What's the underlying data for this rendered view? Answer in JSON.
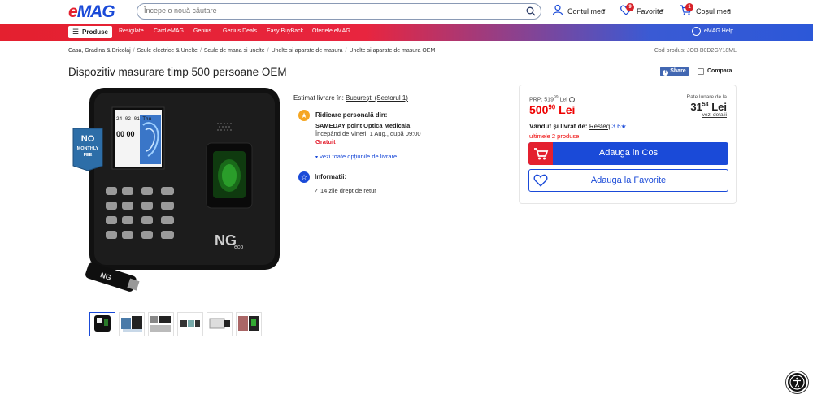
{
  "header": {
    "logo": "eMAG",
    "search_placeholder": "Începe o nouă căutare",
    "account_label": "Contul meu",
    "favorites_label": "Favorite",
    "favorites_count": "9",
    "cart_label": "Coșul meu",
    "cart_count": "1"
  },
  "nav": {
    "produse_label": "Produse",
    "links": [
      "Resigilate",
      "Card eMAG",
      "Genius",
      "Genius Deals",
      "Easy BuyBack",
      "Ofertele eMAG"
    ],
    "help_label": "eMAG Help"
  },
  "breadcrumb": [
    "Casa, Gradina & Bricolaj",
    "Scule electrice & Unelte",
    "Scule de mana si unelte",
    "Unelte si aparate de masura",
    "Unelte si aparate de masura OEM"
  ],
  "product": {
    "code_label": "Cod produs: JOB-B0D2GY18ML",
    "title": "Dispozitiv masurare timp 500 persoane OEM",
    "share_label": "Share",
    "compare_label": "Compara",
    "badge_line1": "NO",
    "badge_line2": "MONTHLY",
    "badge_line3": "FEE",
    "screen_date": "24-02-01 Thu",
    "screen_time": "00 00",
    "brand": "NGeco"
  },
  "delivery": {
    "estimat_label": "Estimat livrare în:",
    "city": "București (Sectorul 1)",
    "pickup_title": "Ridicare personală din:",
    "pickup_point": "SAMEDAY point Optica Medicala",
    "pickup_date": "Începând de Vineri, 1 Aug., după 09:00",
    "pickup_price": "Gratuit",
    "more_options": "vezi toate opțiunile de livrare",
    "info_title": "Informatii:",
    "return_policy": "14 zile drept de retur"
  },
  "pricing": {
    "prp_label": "PRP: 519",
    "prp_decimals": "99",
    "prp_currency": "Lei",
    "price_main": "500",
    "price_decimals": "90",
    "price_currency": "Lei",
    "rate_label": "Rate lunare de la",
    "rate_main": "31",
    "rate_decimals": "53",
    "rate_currency": "Lei",
    "rate_details": "vezi detalii",
    "sold_label": "Vândut și livrat de:",
    "seller": "Resteq",
    "seller_rating": "3.6",
    "stock_note": "ultimele 2 produse",
    "cart_button": "Adauga in Cos",
    "fav_button": "Adauga la Favorite"
  },
  "colors": {
    "brand_red": "#e4202f",
    "brand_blue": "#1a4ad8",
    "price_red": "#ee0000",
    "star_orange": "#f5a623"
  }
}
